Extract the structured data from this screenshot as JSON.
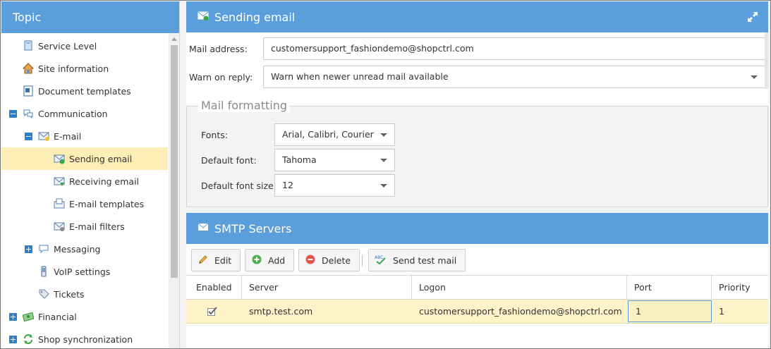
{
  "sidebar": {
    "title": "Topic",
    "items": [
      {
        "label": "Service Level",
        "icon": "book-icon"
      },
      {
        "label": "Site information",
        "icon": "house-icon"
      },
      {
        "label": "Document templates",
        "icon": "document-icon"
      },
      {
        "label": "Communication",
        "icon": "speech-bubbles-icon"
      },
      {
        "label": "E-mail",
        "icon": "envelope-icon"
      },
      {
        "label": "Sending email",
        "icon": "envelope-send-icon"
      },
      {
        "label": "Receiving email",
        "icon": "envelope-receive-icon"
      },
      {
        "label": "E-mail templates",
        "icon": "envelope-template-icon"
      },
      {
        "label": "E-mail filters",
        "icon": "envelope-filter-icon"
      },
      {
        "label": "Messaging",
        "icon": "chat-bubble-icon"
      },
      {
        "label": "VoIP settings",
        "icon": "phone-icon"
      },
      {
        "label": "Tickets",
        "icon": "tag-icon"
      },
      {
        "label": "Financial",
        "icon": "money-icon"
      },
      {
        "label": "Shop synchronization",
        "icon": "sync-icon"
      }
    ]
  },
  "sending": {
    "title": "Sending email",
    "mail_address_label": "Mail address:",
    "mail_address_value": "customersupport_fashiondemo@shopctrl.com",
    "warn_label": "Warn on reply:",
    "warn_value": "Warn when newer unread mail available"
  },
  "formatting": {
    "legend": "Mail formatting",
    "fonts_label": "Fonts:",
    "fonts_value": "Arial, Calibri, Courier",
    "default_font_label": "Default font:",
    "default_font_value": "Tahoma",
    "font_size_label": "Default font size:",
    "font_size_value": "12"
  },
  "smtp": {
    "title": "SMTP Servers",
    "toolbar": {
      "edit": "Edit",
      "add": "Add",
      "delete": "Delete",
      "send_test": "Send test mail"
    },
    "columns": [
      "Enabled",
      "Server",
      "Logon",
      "Port",
      "Priority"
    ],
    "rows": [
      {
        "enabled": true,
        "server": "smtp.test.com",
        "logon": "customersupport_fashiondemo@shopctrl.com",
        "port": "1",
        "priority": "1"
      }
    ]
  },
  "colors": {
    "header_blue": "#5a9fdc",
    "selected_row": "#fdeeb5",
    "expander_blue": "#2b7ed1"
  }
}
